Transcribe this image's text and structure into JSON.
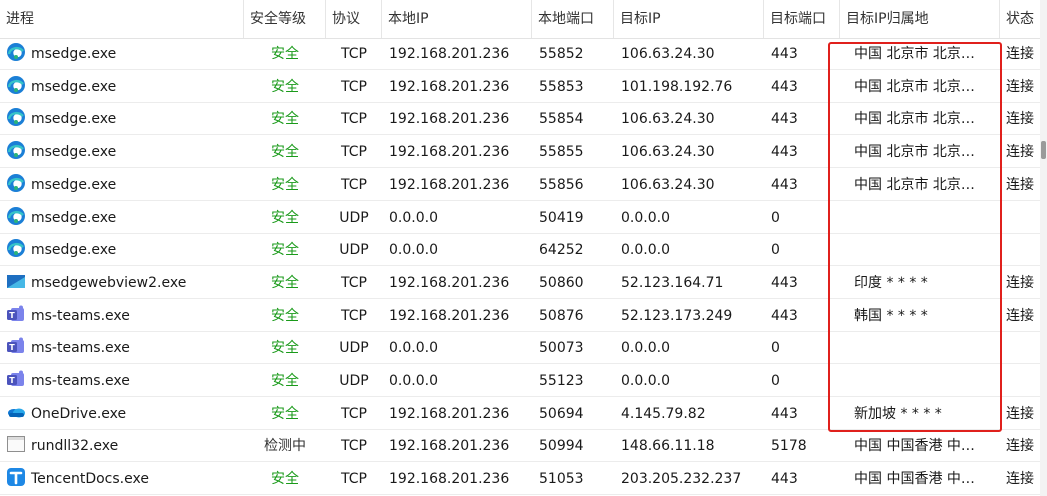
{
  "headers": {
    "process": "进程",
    "security": "安全等级",
    "protocol": "协议",
    "local_ip": "本地IP",
    "local_port": "本地端口",
    "remote_ip": "目标IP",
    "remote_port": "目标端口",
    "location": "目标IP归属地",
    "state": "状态"
  },
  "colors": {
    "safe": "#1a9a1a",
    "highlight": "#e0201c"
  },
  "rows": [
    {
      "process": "msedge.exe",
      "icon": "edge-icon",
      "security": "安全",
      "protocol": "TCP",
      "local_ip": "192.168.201.236",
      "local_port": "55852",
      "remote_ip": "106.63.24.30",
      "remote_port": "443",
      "location": "中国 北京市 北京…",
      "state": "连接"
    },
    {
      "process": "msedge.exe",
      "icon": "edge-icon",
      "security": "安全",
      "protocol": "TCP",
      "local_ip": "192.168.201.236",
      "local_port": "55853",
      "remote_ip": "101.198.192.76",
      "remote_port": "443",
      "location": "中国 北京市 北京…",
      "state": "连接"
    },
    {
      "process": "msedge.exe",
      "icon": "edge-icon",
      "security": "安全",
      "protocol": "TCP",
      "local_ip": "192.168.201.236",
      "local_port": "55854",
      "remote_ip": "106.63.24.30",
      "remote_port": "443",
      "location": "中国 北京市 北京…",
      "state": "连接"
    },
    {
      "process": "msedge.exe",
      "icon": "edge-icon",
      "security": "安全",
      "protocol": "TCP",
      "local_ip": "192.168.201.236",
      "local_port": "55855",
      "remote_ip": "106.63.24.30",
      "remote_port": "443",
      "location": "中国 北京市 北京…",
      "state": "连接"
    },
    {
      "process": "msedge.exe",
      "icon": "edge-icon",
      "security": "安全",
      "protocol": "TCP",
      "local_ip": "192.168.201.236",
      "local_port": "55856",
      "remote_ip": "106.63.24.30",
      "remote_port": "443",
      "location": "中国 北京市 北京…",
      "state": "连接"
    },
    {
      "process": "msedge.exe",
      "icon": "edge-icon",
      "security": "安全",
      "protocol": "UDP",
      "local_ip": "0.0.0.0",
      "local_port": "50419",
      "remote_ip": "0.0.0.0",
      "remote_port": "0",
      "location": "",
      "state": ""
    },
    {
      "process": "msedge.exe",
      "icon": "edge-icon",
      "security": "安全",
      "protocol": "UDP",
      "local_ip": "0.0.0.0",
      "local_port": "64252",
      "remote_ip": "0.0.0.0",
      "remote_port": "0",
      "location": "",
      "state": ""
    },
    {
      "process": "msedgewebview2.exe",
      "icon": "webview-icon",
      "security": "安全",
      "protocol": "TCP",
      "local_ip": "192.168.201.236",
      "local_port": "50860",
      "remote_ip": "52.123.164.71",
      "remote_port": "443",
      "location": "印度 * * * *",
      "state": "连接"
    },
    {
      "process": "ms-teams.exe",
      "icon": "teams-icon",
      "security": "安全",
      "protocol": "TCP",
      "local_ip": "192.168.201.236",
      "local_port": "50876",
      "remote_ip": "52.123.173.249",
      "remote_port": "443",
      "location": "韩国 * * * *",
      "state": "连接"
    },
    {
      "process": "ms-teams.exe",
      "icon": "teams-icon",
      "security": "安全",
      "protocol": "UDP",
      "local_ip": "0.0.0.0",
      "local_port": "50073",
      "remote_ip": "0.0.0.0",
      "remote_port": "0",
      "location": "",
      "state": ""
    },
    {
      "process": "ms-teams.exe",
      "icon": "teams-icon",
      "security": "安全",
      "protocol": "UDP",
      "local_ip": "0.0.0.0",
      "local_port": "55123",
      "remote_ip": "0.0.0.0",
      "remote_port": "0",
      "location": "",
      "state": ""
    },
    {
      "process": "OneDrive.exe",
      "icon": "onedrive-icon",
      "security": "安全",
      "protocol": "TCP",
      "local_ip": "192.168.201.236",
      "local_port": "50694",
      "remote_ip": "4.145.79.82",
      "remote_port": "443",
      "location": "新加坡 * * * *",
      "state": "连接"
    },
    {
      "process": "rundll32.exe",
      "icon": "window-icon",
      "security": "检测中",
      "protocol": "TCP",
      "local_ip": "192.168.201.236",
      "local_port": "50994",
      "remote_ip": "148.66.11.18",
      "remote_port": "5178",
      "location": "中国 中国香港 中…",
      "state": "连接"
    },
    {
      "process": "TencentDocs.exe",
      "icon": "tencentdocs-icon",
      "security": "安全",
      "protocol": "TCP",
      "local_ip": "192.168.201.236",
      "local_port": "51053",
      "remote_ip": "203.205.232.237",
      "remote_port": "443",
      "location": "中国 中国香港 中…",
      "state": "连接"
    }
  ]
}
